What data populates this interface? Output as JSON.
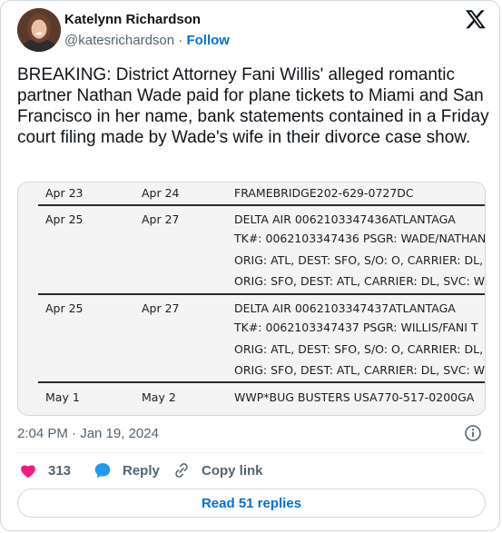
{
  "author": {
    "name": "Katelynn Richardson",
    "handle": "@katesrichardson",
    "separator": "·",
    "follow_label": "Follow"
  },
  "tweet": {
    "text": "BREAKING: District Attorney Fani Willis' alleged romantic partner Nathan Wade paid for plane tickets to Miami and San Francisco in her name, bank statements contained in a Friday court filing made by Wade's wife in their divorce case show.",
    "timestamp": "2:04 PM · Jan 19, 2024"
  },
  "document": {
    "rows": [
      {
        "date1": "Apr 23",
        "date2": "Apr 24",
        "desc": "FRAMEBRIDGE202-629-0727DC"
      },
      {
        "date1": "Apr 25",
        "date2": "Apr 27",
        "desc": "DELTA AIR    0062103347436ATLANTAGA",
        "lines": [
          "TK#: 0062103347436 PSGR: WADE/NATHAN",
          "ORIG: ATL, DEST: SFO, S/O: O, CARRIER: DL,",
          "ORIG: SFO, DEST: ATL, CARRIER: DL, SVC: W"
        ]
      },
      {
        "date1": "Apr 25",
        "date2": "Apr 27",
        "desc": "DELTA AIR    0062103347437ATLANTAGA",
        "lines": [
          "TK#: 0062103347437 PSGR: WILLIS/FANI T",
          "ORIG: ATL, DEST: SFO, S/O: O, CARRIER: DL,",
          "ORIG: SFO, DEST: ATL, CARRIER: DL, SVC: W"
        ]
      },
      {
        "date1": "May 1",
        "date2": "May 2",
        "desc": "WWP*BUG BUSTERS USA770-517-0200GA"
      }
    ]
  },
  "actions": {
    "like_count": "313",
    "reply_label": "Reply",
    "copy_link_label": "Copy link",
    "read_replies_label": "Read 51 replies"
  },
  "colors": {
    "accent": "#006fd6",
    "like": "#f91880",
    "muted": "#536471"
  }
}
